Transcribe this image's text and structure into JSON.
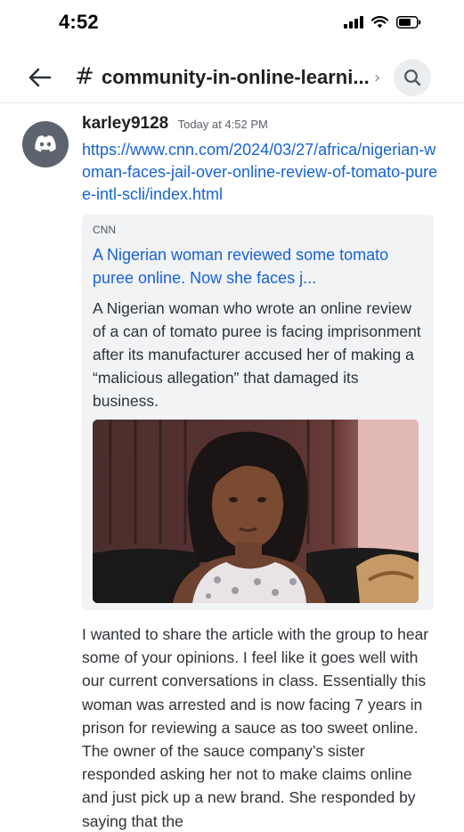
{
  "status_bar": {
    "time": "4:52"
  },
  "header": {
    "hash_symbol": "#",
    "channel_name": "community-in-online-learni...",
    "chevron": "›"
  },
  "message": {
    "author": "karley9128",
    "timestamp": "Today at 4:52 PM",
    "link": "https://www.cnn.com/2024/03/27/africa/nigerian-woman-faces-jail-over-online-review-of-tomato-puree-intl-scli/index.html",
    "embed": {
      "provider": "CNN",
      "title": "A Nigerian woman reviewed some tomato puree online. Now she faces j...",
      "description": "A Nigerian woman who wrote an online review of a can of tomato puree is facing imprisonment after its manufacturer accused her of making a “malicious allegation” that damaged its business."
    },
    "text": "I wanted to share the article with the group to hear some of your opinions. I feel like it goes well with our current conversations in class. Essentially this woman was arrested and is now facing 7 years in prison for reviewing a sauce as too sweet online. The owner of the sauce company’s sister responded asking her not to make claims online and just pick up a new brand. She responded by saying that the"
  },
  "colors": {
    "link": "#1663d6",
    "avatar_bg": "#5d6470",
    "embed_bg": "#f2f3f5"
  },
  "icons": {
    "back": "arrow-left-icon",
    "search": "search-icon",
    "avatar": "discord-logo-icon"
  }
}
